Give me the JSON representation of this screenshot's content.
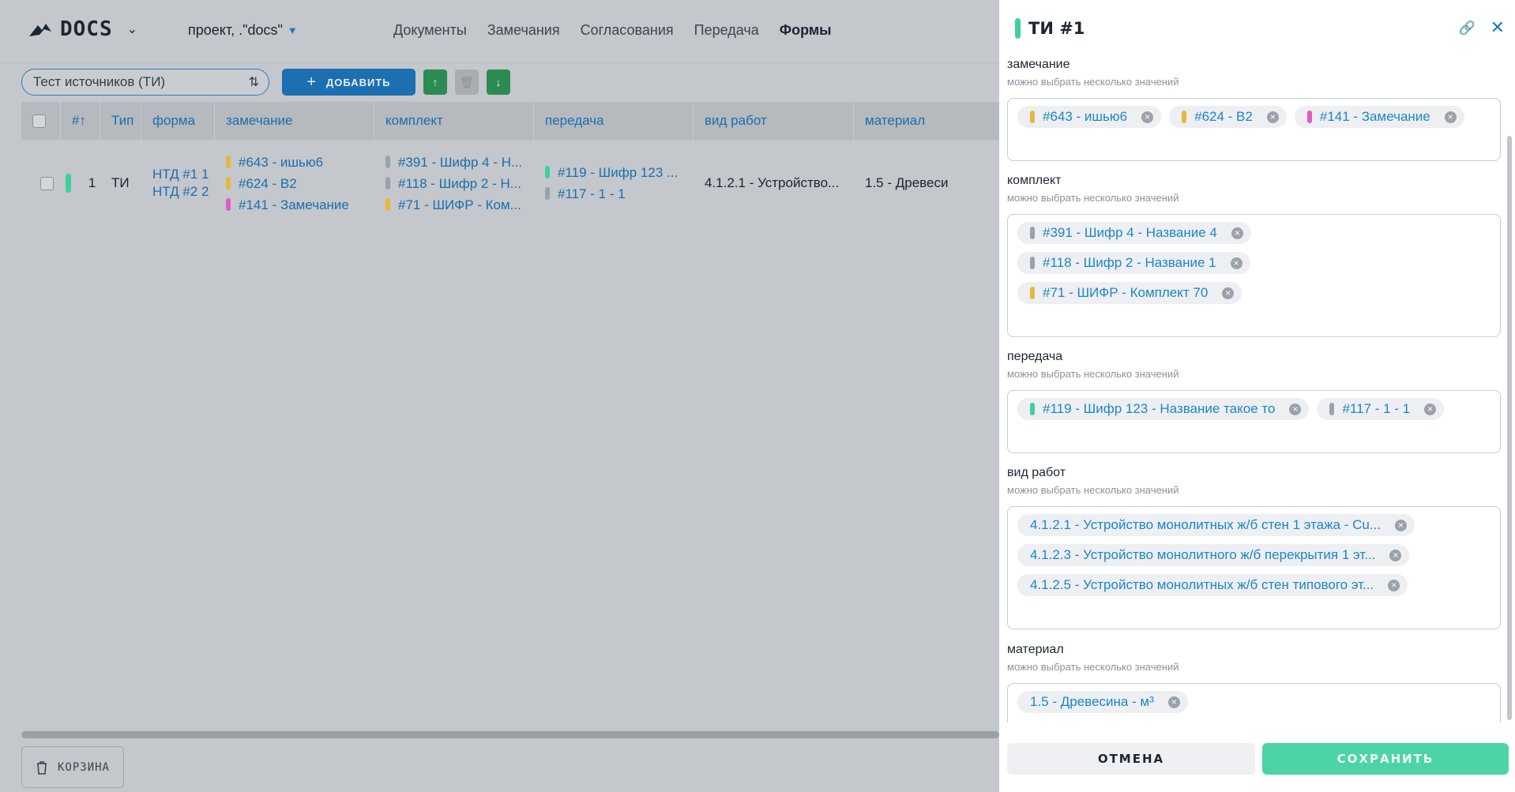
{
  "colors": {
    "yellow": "#e7b73c",
    "pink": "#e05ac4",
    "gray": "#9aa2ab",
    "green": "#3fcf9c",
    "accent": "#1a7bc0"
  },
  "header": {
    "brand": "DOCS",
    "project": "проект, .\"docs\"",
    "nav": [
      "Документы",
      "Замечания",
      "Согласования",
      "Передача",
      "Формы"
    ],
    "active_nav": "Формы"
  },
  "toolbar": {
    "search_value": "Тест источников (ТИ)",
    "add_label": "ДОБАВИТЬ"
  },
  "table": {
    "columns": [
      "#↑",
      "Тип",
      "форма",
      "замечание",
      "комплект",
      "передача",
      "вид работ",
      "материал"
    ],
    "rows": [
      {
        "num": "1",
        "type": "ТИ",
        "forms": [
          "НТД #1 1",
          "НТД #2 2"
        ],
        "remarks": [
          "#643 - ишью6",
          "#624 - В2",
          "#141 - Замечание"
        ],
        "sets": [
          "#391 - Шифр 4 - Н...",
          "#118 - Шифр 2 - Н...",
          "#71 - ШИФР - Ком..."
        ],
        "transfers": [
          "#119 - Шифр 123 ...",
          "#117 - 1 - 1"
        ],
        "work": "4.1.2.1 - Устройство...",
        "material": "1.5 - Древеси"
      }
    ]
  },
  "trash_label": "КОРЗИНА",
  "panel": {
    "title": "ТИ #1",
    "fields": [
      {
        "label": "замечание",
        "hint": "можно выбрать несколько значений",
        "chips": [
          {
            "text": "#643 - ишью6",
            "color": "yellow"
          },
          {
            "text": "#624 - В2",
            "color": "yellow"
          },
          {
            "text": "#141 - Замечание",
            "color": "pink"
          }
        ]
      },
      {
        "label": "комплект",
        "hint": "можно выбрать несколько значений",
        "chips": [
          {
            "text": "#391 - Шифр 4 - Название 4",
            "color": "gray"
          },
          {
            "text": "#118 - Шифр 2 - Название 1",
            "color": "gray"
          },
          {
            "text": "#71 - ШИФР - Комплект 70",
            "color": "yellow"
          }
        ]
      },
      {
        "label": "передача",
        "hint": "можно выбрать несколько значений",
        "chips": [
          {
            "text": "#119 - Шифр 123 - Название такое то",
            "color": "green"
          },
          {
            "text": "#117 - 1 - 1",
            "color": "gray"
          }
        ]
      },
      {
        "label": "вид работ",
        "hint": "можно выбрать несколько значений",
        "chips": [
          {
            "text": "4.1.2.1 - Устройство монолитных ж/б стен 1 этажа - Сu...",
            "color": ""
          },
          {
            "text": "4.1.2.3 - Устройство монолитного ж/б перекрытия 1 эт...",
            "color": ""
          },
          {
            "text": "4.1.2.5 - Устройство монолитных ж/б стен типового эт...",
            "color": ""
          }
        ]
      },
      {
        "label": "материал",
        "hint": "можно выбрать несколько значений",
        "chips": [
          {
            "text": "1.5 - Древесина - м³",
            "color": ""
          }
        ]
      }
    ],
    "cancel_label": "ОТМЕНА",
    "save_label": "СОХРАНИТЬ"
  }
}
